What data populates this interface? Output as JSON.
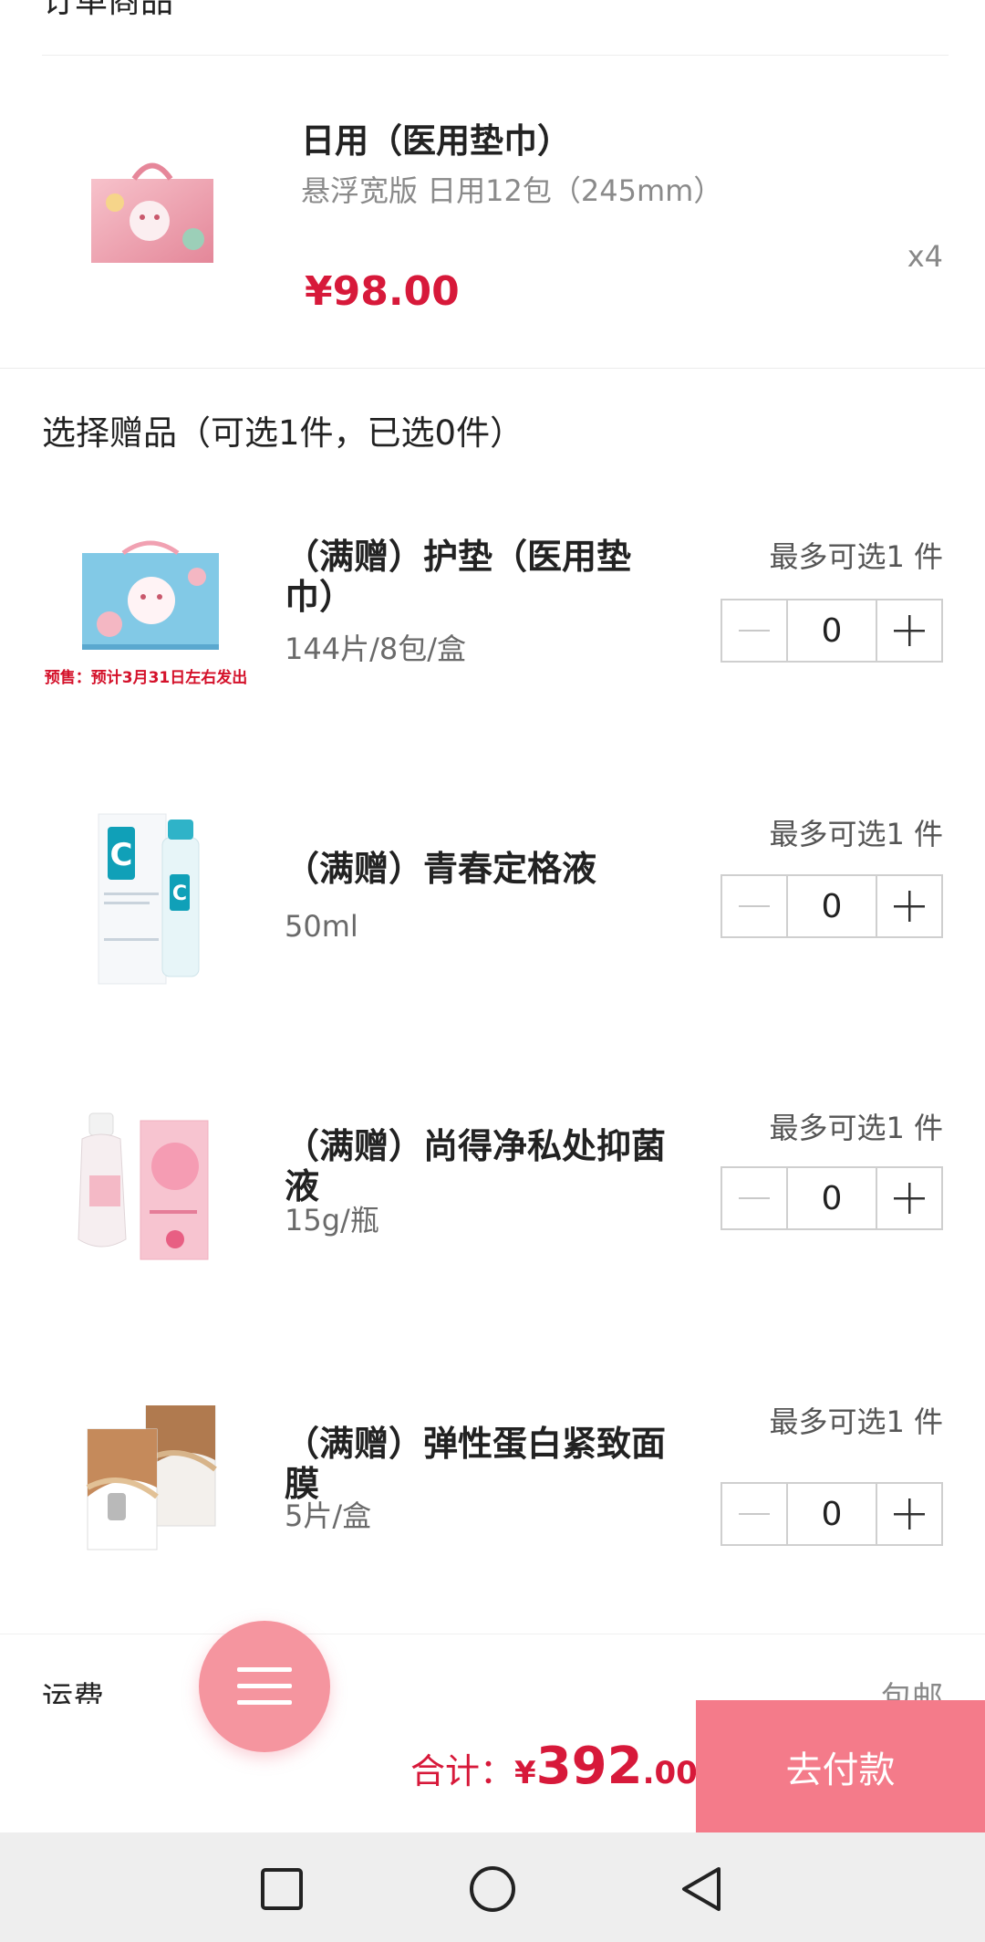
{
  "order": {
    "section_title": "订单商品",
    "item": {
      "name": "日用（医用垫巾）",
      "spec": "悬浮宽版 日用12包（245mm）",
      "price": "¥98.00",
      "qty": "x4"
    }
  },
  "gifts": {
    "title": "选择赠品（可选1件，已选0件）",
    "items": [
      {
        "name": "（满赠）护垫（医用垫巾）",
        "spec": "144片/8包/盒",
        "max": "最多可选1 件",
        "qty": "0",
        "banner": "预售：预计3月31日左右发出"
      },
      {
        "name": "（满赠）青春定格液",
        "spec": "50ml",
        "max": "最多可选1 件",
        "qty": "0"
      },
      {
        "name": "（满赠）尚得净私处抑菌液",
        "spec": "15g/瓶",
        "max": "最多可选1 件",
        "qty": "0"
      },
      {
        "name": "（满赠）弹性蛋白紧致面膜",
        "spec": "5片/盒",
        "max": "最多可选1 件",
        "qty": "0"
      }
    ]
  },
  "shipping": {
    "label": "运费",
    "value": "包邮"
  },
  "total": {
    "label": "合计：",
    "currency": "¥",
    "integer": "392",
    "decimal": ".00"
  },
  "pay_button": "去付款",
  "colors": {
    "accent": "#d7193a",
    "pay": "#f47b8a",
    "fab": "#f5959f"
  },
  "icons": [
    "menu-icon",
    "square-icon",
    "circle-icon",
    "triangle-back-icon",
    "minus-icon",
    "plus-icon"
  ]
}
